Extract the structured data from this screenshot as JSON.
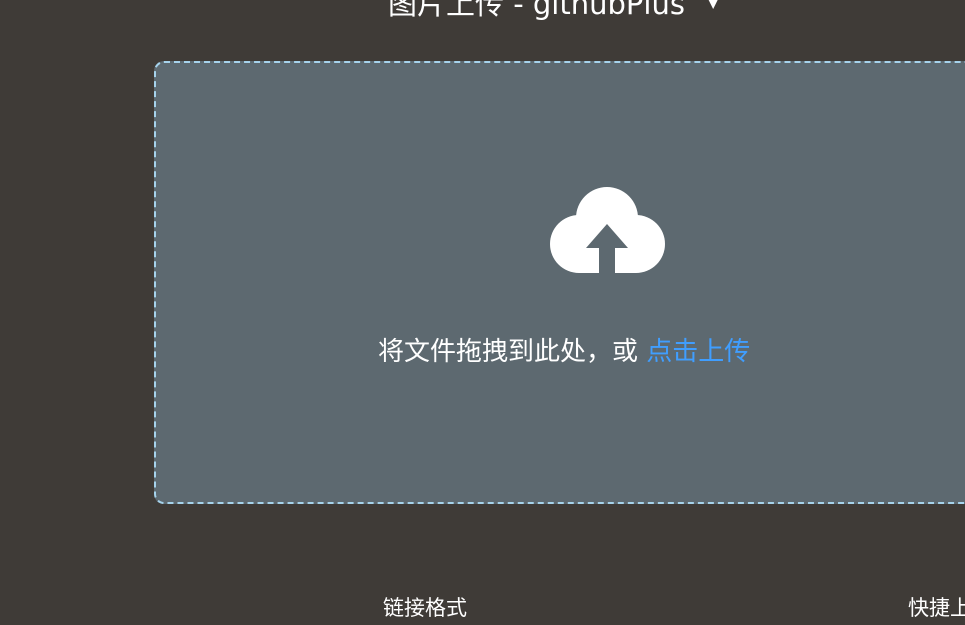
{
  "header": {
    "title": "图片上传 - githubPlus",
    "dropdown_icon": "chevron-down-icon"
  },
  "dropzone": {
    "icon": "cloud-upload-icon",
    "prompt": "将文件拖拽到此处，或",
    "link": "点击上传"
  },
  "footer": {
    "link_format_label": "链接格式",
    "shortcut_label": "快捷上传"
  },
  "colors": {
    "background": "#3f3b37",
    "dropzone_fill": "#5d6970",
    "dropzone_border": "#a6d3ec",
    "link": "#409eff"
  }
}
